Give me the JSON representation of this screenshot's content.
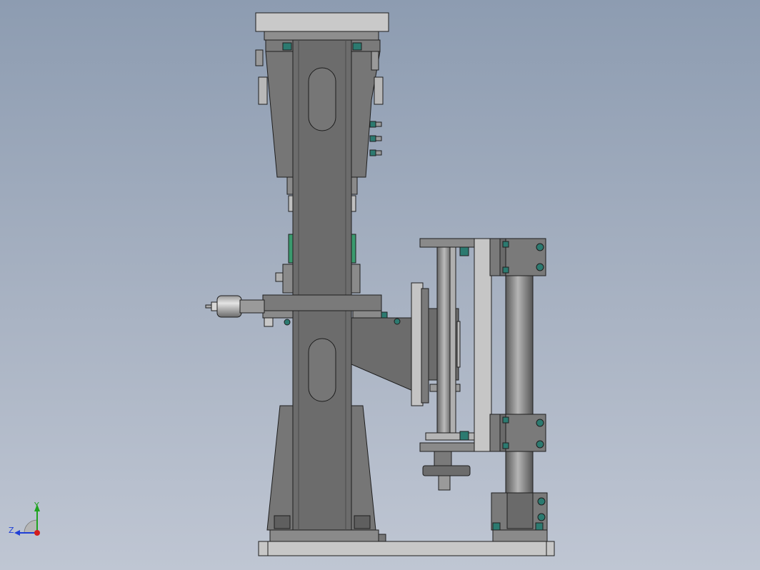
{
  "viewport": {
    "background_top": "#8d9cb1",
    "background_bottom": "#bfc6d3"
  },
  "model": {
    "body_color": "#6c6c6c",
    "edge_color": "#1e1e1e",
    "light_part_color": "#c8c8c8",
    "fastener_color": "#2c7a70",
    "icon": "vertical-column-machine-assembly"
  },
  "triad": {
    "y_label": "Y",
    "z_label": "Z",
    "y_color": "#1fa31f",
    "z_color": "#1f3fd6",
    "x_color": "#d41c1c"
  }
}
